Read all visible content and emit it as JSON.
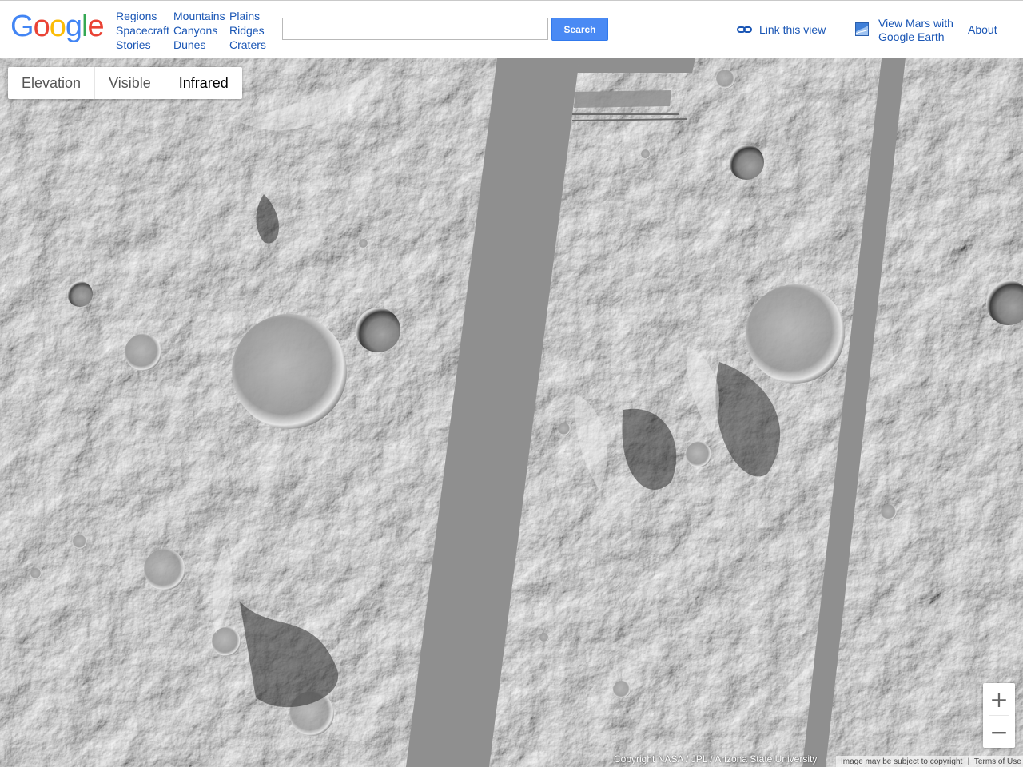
{
  "header": {
    "logo_letters": [
      {
        "ch": "G",
        "color": "#4285f4"
      },
      {
        "ch": "o",
        "color": "#ea4335"
      },
      {
        "ch": "o",
        "color": "#fbbc05"
      },
      {
        "ch": "g",
        "color": "#4285f4"
      },
      {
        "ch": "l",
        "color": "#34a853"
      },
      {
        "ch": "e",
        "color": "#ea4335"
      }
    ],
    "nav": [
      {
        "label": "Regions"
      },
      {
        "label": "Mountains"
      },
      {
        "label": "Plains"
      },
      {
        "label": "Spacecraft"
      },
      {
        "label": "Canyons"
      },
      {
        "label": "Ridges"
      },
      {
        "label": "Stories"
      },
      {
        "label": "Dunes"
      },
      {
        "label": "Craters"
      }
    ],
    "search": {
      "value": "",
      "placeholder": "",
      "button_label": "Search"
    },
    "link_view_label": "Link this view",
    "earth_link_line1": "View Mars with",
    "earth_link_line2": "Google Earth",
    "about_label": "About",
    "accent_color": "#4a8af4",
    "link_color": "#1a56b5"
  },
  "map": {
    "layer_tabs": [
      {
        "label": "Elevation",
        "active": false
      },
      {
        "label": "Visible",
        "active": false
      },
      {
        "label": "Infrared",
        "active": true
      }
    ],
    "zoom_in_label": "+",
    "zoom_out_label": "−",
    "copyright": "Copyright NASA / JPL / Arizona State University",
    "image_notice": "Image may be subject to copyright",
    "terms_label": "Terms of Use"
  }
}
